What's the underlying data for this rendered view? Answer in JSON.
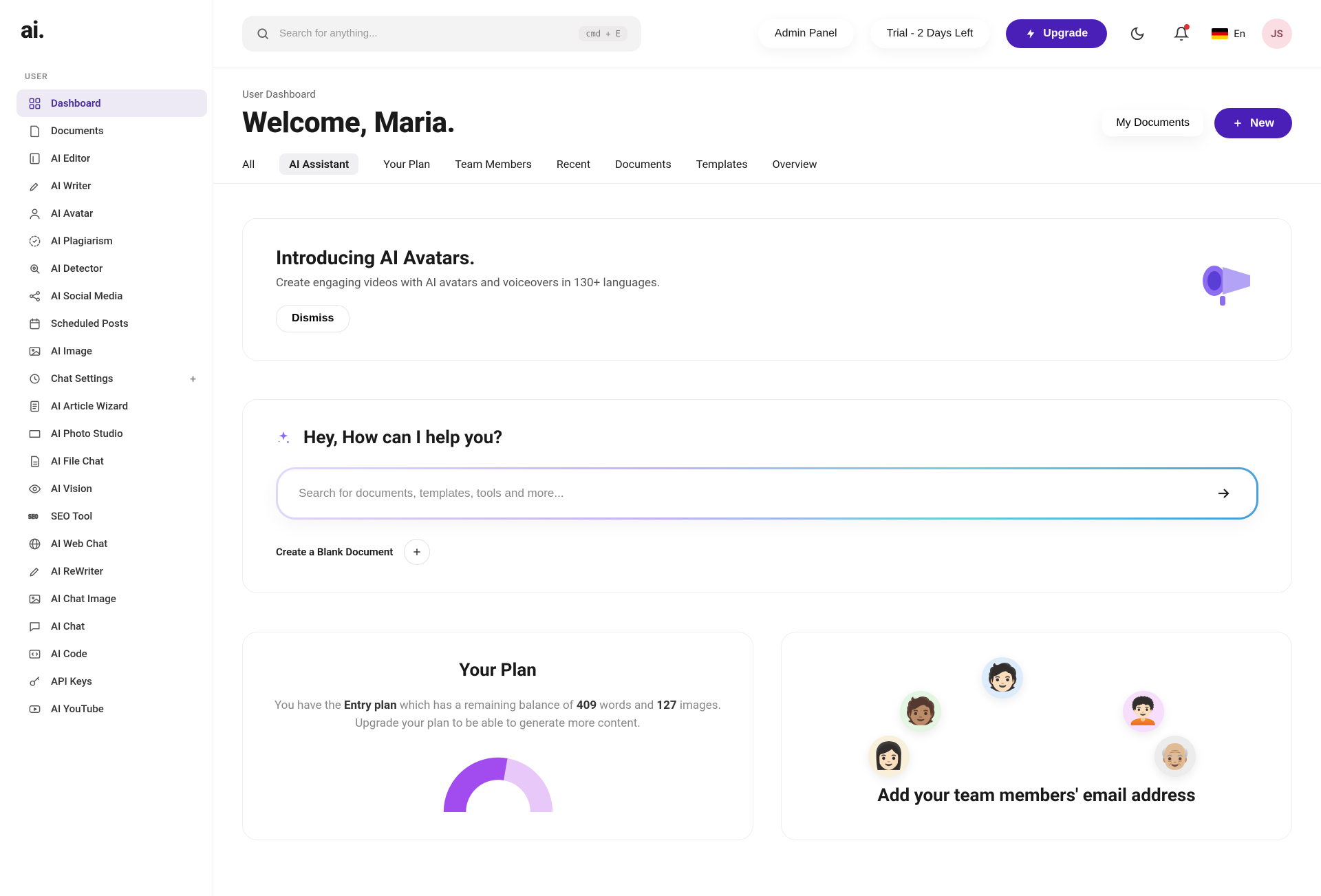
{
  "logo": "ai.",
  "sidebar": {
    "section_label": "User",
    "items": [
      {
        "label": "Dashboard",
        "icon": "dashboard-icon",
        "active": true
      },
      {
        "label": "Documents",
        "icon": "documents-icon"
      },
      {
        "label": "AI Editor",
        "icon": "editor-icon"
      },
      {
        "label": "AI Writer",
        "icon": "writer-icon"
      },
      {
        "label": "AI Avatar",
        "icon": "avatar-icon"
      },
      {
        "label": "AI Plagiarism",
        "icon": "plagiarism-icon"
      },
      {
        "label": "AI Detector",
        "icon": "detector-icon"
      },
      {
        "label": "AI Social Media",
        "icon": "social-icon"
      },
      {
        "label": "Scheduled Posts",
        "icon": "scheduled-icon"
      },
      {
        "label": "AI Image",
        "icon": "image-icon"
      },
      {
        "label": "Chat Settings",
        "icon": "chat-settings-icon",
        "trailing_plus": true
      },
      {
        "label": "AI Article Wizard",
        "icon": "article-icon"
      },
      {
        "label": "AI Photo Studio",
        "icon": "photo-icon"
      },
      {
        "label": "AI File Chat",
        "icon": "file-icon"
      },
      {
        "label": "AI Vision",
        "icon": "vision-icon"
      },
      {
        "label": "SEO Tool",
        "icon": "seo-icon"
      },
      {
        "label": "AI Web Chat",
        "icon": "web-icon"
      },
      {
        "label": "AI ReWriter",
        "icon": "rewriter-icon"
      },
      {
        "label": "AI Chat Image",
        "icon": "chat-image-icon"
      },
      {
        "label": "AI Chat",
        "icon": "chat-icon"
      },
      {
        "label": "AI Code",
        "icon": "code-icon"
      },
      {
        "label": "API Keys",
        "icon": "key-icon"
      },
      {
        "label": "AI YouTube",
        "icon": "youtube-icon"
      }
    ]
  },
  "topbar": {
    "search_placeholder": "Search for anything...",
    "kbd": "cmd  +  E",
    "admin_label": "Admin Panel",
    "trial_label": "Trial - 2 Days Left",
    "upgrade_label": "Upgrade",
    "lang_label": "En",
    "avatar_initials": "JS"
  },
  "header": {
    "breadcrumb": "User Dashboard",
    "welcome": "Welcome, Maria.",
    "my_documents": "My Documents",
    "new_label": "New"
  },
  "tabs": [
    "All",
    "AI Assistant",
    "Your Plan",
    "Team Members",
    "Recent",
    "Documents",
    "Templates",
    "Overview"
  ],
  "active_tab": "AI Assistant",
  "announce": {
    "title": "Introducing AI Avatars.",
    "body": "Create engaging videos with AI avatars and voiceovers in 130+ languages.",
    "dismiss": "Dismiss"
  },
  "assistant": {
    "title": "Hey, How can I help you?",
    "search_placeholder": "Search for documents, templates, tools and more...",
    "create_blank": "Create a Blank Document"
  },
  "plan": {
    "title": "Your Plan",
    "prefix": "You have the ",
    "plan_name": "Entry plan",
    "mid1": " which has a remaining balance of ",
    "words": "409",
    "mid2": " words and ",
    "images": "127",
    "suffix": " images. Upgrade your plan to be able to generate more content."
  },
  "team": {
    "title": "Add your team members' email address"
  },
  "colors": {
    "primary": "#4a1fb8",
    "accent": "#a24cf0"
  }
}
